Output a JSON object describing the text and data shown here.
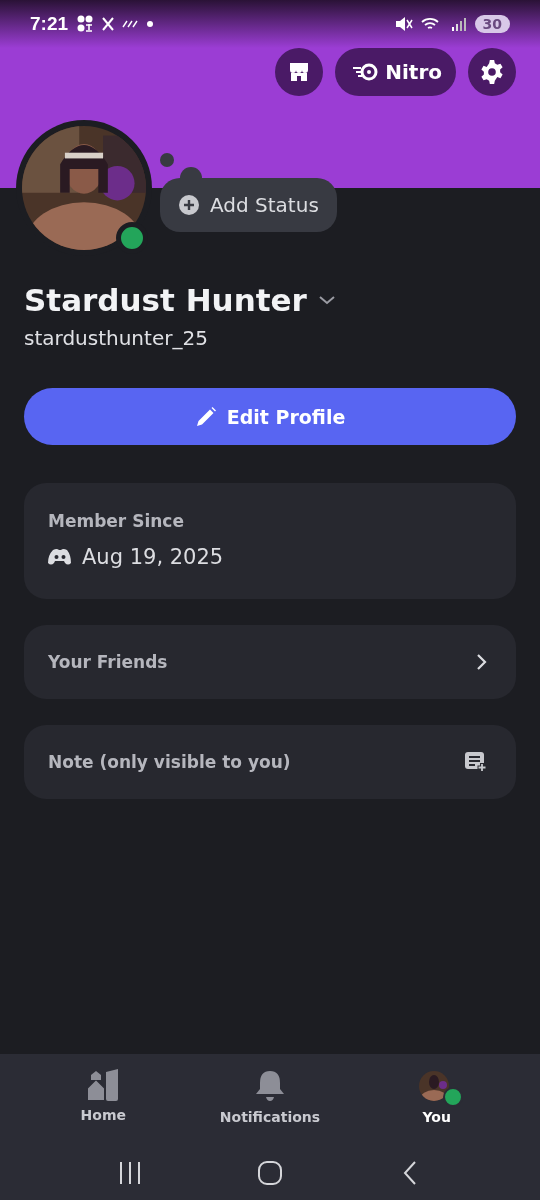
{
  "status_bar": {
    "time": "7:21",
    "battery": "30"
  },
  "header": {
    "nitro_label": "Nitro"
  },
  "profile": {
    "online": true,
    "status_button": "Add Status",
    "display_name": "Stardust Hunter",
    "username": "stardusthunter_25",
    "edit_button": "Edit Profile"
  },
  "cards": [
    {
      "kind": "member",
      "title": "Member Since",
      "value": "Aug 19, 2025"
    },
    {
      "kind": "link",
      "title": "Your Friends"
    },
    {
      "kind": "note",
      "title": "Note (only visible to you)"
    }
  ],
  "nav": [
    {
      "kind": "home",
      "label": "Home",
      "selected": false
    },
    {
      "kind": "bell",
      "label": "Notifications",
      "selected": false
    },
    {
      "kind": "avatar",
      "label": "You",
      "selected": true
    }
  ]
}
